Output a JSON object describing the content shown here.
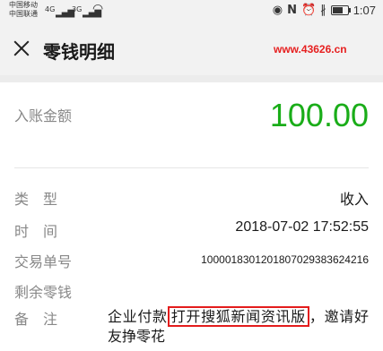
{
  "status_bar": {
    "carrier_1": "中国移动",
    "carrier_2": "中国联通",
    "signal_1": "4G",
    "signal_2": "3G",
    "time": "1:07"
  },
  "nav": {
    "title": "零钱明细",
    "watermark": "www.43626.cn"
  },
  "amount": {
    "label": "入账金额",
    "value": "100.00"
  },
  "details": {
    "type_label": "类　型",
    "type_value": "收入",
    "time_label": "时　间",
    "time_value": "2018-07-02 17:52:55",
    "order_label": "交易单号",
    "order_value": "100001830120180702938362421​6",
    "balance_label": "剩余零钱",
    "balance_value": "",
    "remark_label": "备　注",
    "remark_prefix": "企业付款",
    "remark_highlight": "打开搜狐新闻资讯版",
    "remark_suffix": "，邀请好友挣零花"
  },
  "colors": {
    "amount_green": "#1aad19",
    "watermark_red": "#e62020",
    "highlight_red": "#e31c1c"
  }
}
